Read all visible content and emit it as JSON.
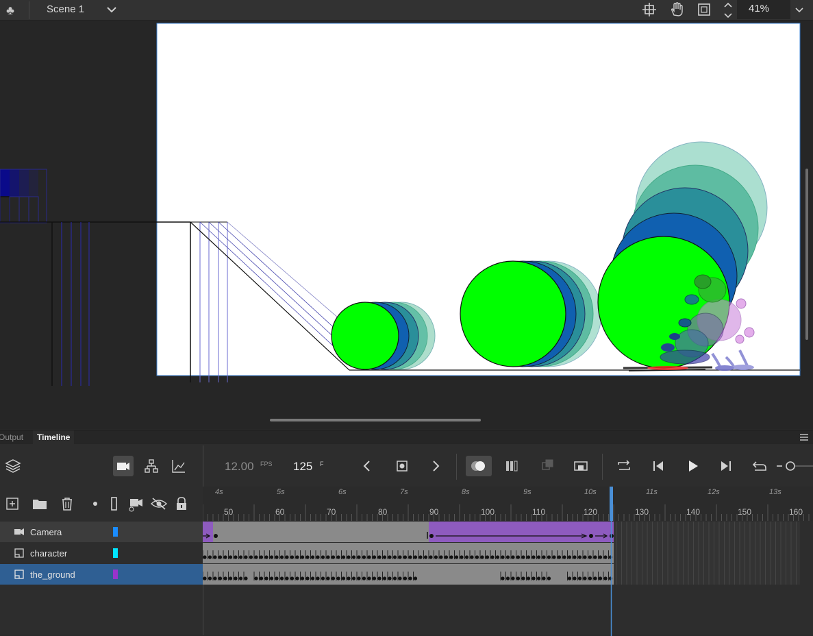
{
  "topbar": {
    "scene_name": "Scene 1",
    "zoom_value": "41%"
  },
  "panel": {
    "tab_output": "Output",
    "tab_timeline": "Timeline"
  },
  "timeline": {
    "fps_value": "12.00",
    "fps_unit": "FPS",
    "current_frame": "125",
    "frame_unit": "F",
    "seconds_labels": [
      "4s",
      "5s",
      "6s",
      "7s",
      "8s",
      "9s",
      "10s",
      "11s",
      "12s",
      "13s"
    ],
    "frame_labels": [
      "50",
      "60",
      "70",
      "80",
      "90",
      "100",
      "110",
      "120",
      "130",
      "140",
      "150",
      "160"
    ]
  },
  "layers": [
    {
      "name": "Camera",
      "color": "#1a8cff",
      "icon": "camera-icon"
    },
    {
      "name": "character",
      "color": "#00e5ff",
      "icon": "layer-icon"
    },
    {
      "name": "the_ground",
      "color": "#9933cc",
      "icon": "layer-icon"
    }
  ],
  "colors": {
    "accent_blue": "#2f5f93",
    "stage_white": "#ffffff",
    "ball_green": "#00ff00",
    "camera_tween": "#8e5bbf",
    "playhead": "#4a8fd6"
  }
}
